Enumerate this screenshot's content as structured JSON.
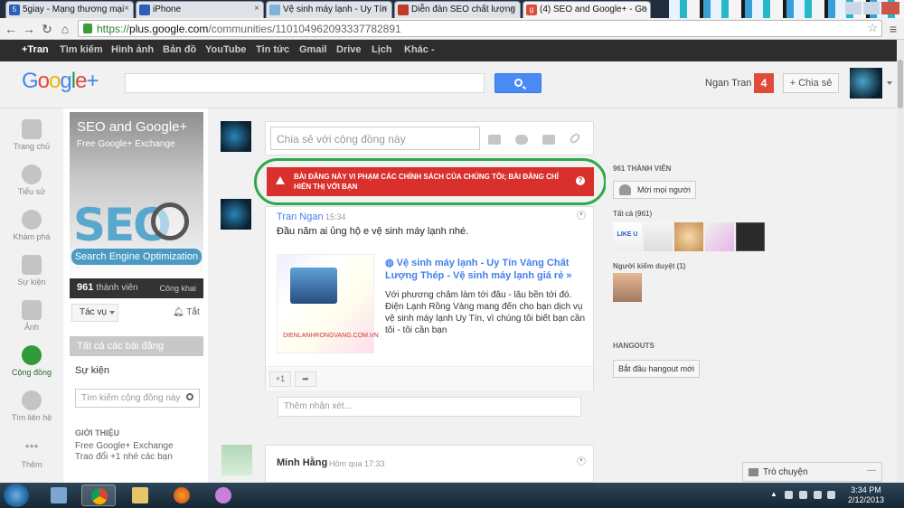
{
  "browser": {
    "tabs": [
      {
        "label": "5giay - Mạng thương mại"
      },
      {
        "label": "iPhone"
      },
      {
        "label": "Vệ sinh máy lạnh - Uy Tín"
      },
      {
        "label": "Diễn đàn SEO chất lượng"
      },
      {
        "label": "(4) SEO and Google+ - Go"
      }
    ],
    "url_scheme": "https://",
    "url_host": "plus.google.com",
    "url_path": "/communities/110104962093337782891"
  },
  "gbar": {
    "items": [
      "+Tran",
      "Tìm kiếm",
      "Hình ảnh",
      "Bản đồ",
      "YouTube",
      "Tin tức",
      "Gmail",
      "Drive",
      "Lịch",
      "Khác -"
    ]
  },
  "header": {
    "logo": "Google+",
    "user_name": "Ngan Tran",
    "notifications": "4",
    "share_label": "+ Chia sẻ"
  },
  "left_nav": [
    {
      "label": "Trang chủ",
      "icon": "home-icon"
    },
    {
      "label": "Tiểu sử",
      "icon": "profile-icon"
    },
    {
      "label": "Khám phá",
      "icon": "explore-icon"
    },
    {
      "label": "Sự kiện",
      "icon": "calendar-icon"
    },
    {
      "label": "Ảnh",
      "icon": "camera-icon"
    },
    {
      "label": "Cộng đồng",
      "icon": "communities-icon"
    },
    {
      "label": "Tìm liên hệ",
      "icon": "find-people-icon"
    },
    {
      "label": "Thêm",
      "icon": "more-icon"
    }
  ],
  "community": {
    "title": "SEO and Google+",
    "subtitle": "Free Google+ Exchange",
    "banner_text": "SEO",
    "banner_caption": "Search Engine Optimization",
    "member_count": "961",
    "member_label": "thành viên",
    "visibility": "Công khai",
    "actions_label": "Tác vụ",
    "mute_label": "Tắt",
    "all_posts": "Tất cả các bài đăng",
    "events": "Sự kiện",
    "search_placeholder": "Tìm kiếm cộng đồng này",
    "about_heading": "GIỚI THIỆU",
    "about_line1": "Free Google+ Exchange",
    "about_line2": "Trao đổi +1 nhé các bạn"
  },
  "stream": {
    "share_placeholder": "Chia sẻ với cộng đồng này",
    "warning": "BÀI ĐĂNG NÀY VI PHẠM CÁC CHÍNH SÁCH CỦA CHÚNG TÔI; BÀI ĐĂNG CHỈ HIỂN THỊ VỚI BẠN",
    "post1": {
      "author": "Tran Ngan",
      "time": "15:34",
      "text": "Đầu năm ai ủng hộ e vệ sinh máy lạnh nhé.",
      "image_caption": "DIENLANHRONGVANG.COM.VN",
      "link_title": "Vệ sinh máy lạnh - Uy Tín Vàng Chất Lượng Thép - Vệ sinh máy lạnh giá rẻ »",
      "link_desc": "Với phương châm làm tới đâu - lâu bền tới đó. Điện Lạnh Rồng Vàng mang đến cho bạn dịch vụ vệ sinh máy lạnh Uy Tín, vì chúng tôi biết bạn cần tôi - tôi cần bạn",
      "plus_one": "+1"
    },
    "comment_placeholder": "Thêm nhận xét...",
    "post2": {
      "author": "Minh Hằng",
      "time": "Hôm qua 17:33"
    }
  },
  "right": {
    "members_heading": "961 THÀNH VIÊN",
    "invite_label": "Mời mọi người",
    "all_label": "Tất cả (961)",
    "moderators_label": "Người kiểm duyệt (1)",
    "hangouts_heading": "HANGOUTS",
    "hangout_button": "Bắt đầu hangout mới",
    "likeu_text": "LIKE U",
    "chat_label": "Trò chuyện"
  },
  "taskbar": {
    "time": "3:34 PM",
    "date": "2/12/2013"
  }
}
